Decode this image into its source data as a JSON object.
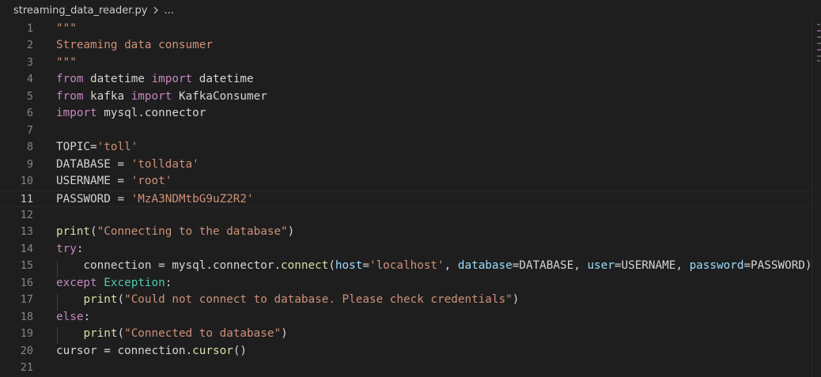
{
  "breadcrumb": {
    "file": "streaming_data_reader.py",
    "more": "..."
  },
  "editor": {
    "active_line": 11,
    "lines": [
      {
        "n": "1",
        "tokens": [
          {
            "t": "\"\"\"",
            "c": "str"
          }
        ]
      },
      {
        "n": "2",
        "tokens": [
          {
            "t": "Streaming data consumer",
            "c": "str"
          }
        ]
      },
      {
        "n": "3",
        "tokens": [
          {
            "t": "\"\"\"",
            "c": "str"
          }
        ]
      },
      {
        "n": "4",
        "tokens": [
          {
            "t": "from",
            "c": "kw"
          },
          {
            "t": " datetime ",
            "c": "plain"
          },
          {
            "t": "import",
            "c": "kw"
          },
          {
            "t": " datetime",
            "c": "plain"
          }
        ]
      },
      {
        "n": "5",
        "tokens": [
          {
            "t": "from",
            "c": "kw"
          },
          {
            "t": " kafka ",
            "c": "plain"
          },
          {
            "t": "import",
            "c": "kw"
          },
          {
            "t": " KafkaConsumer",
            "c": "plain"
          }
        ]
      },
      {
        "n": "6",
        "tokens": [
          {
            "t": "import",
            "c": "kw"
          },
          {
            "t": " mysql.connector",
            "c": "plain"
          }
        ]
      },
      {
        "n": "7",
        "tokens": []
      },
      {
        "n": "8",
        "tokens": [
          {
            "t": "TOPIC=",
            "c": "plain"
          },
          {
            "t": "'toll'",
            "c": "str"
          }
        ]
      },
      {
        "n": "9",
        "tokens": [
          {
            "t": "DATABASE = ",
            "c": "plain"
          },
          {
            "t": "'tolldata'",
            "c": "str"
          }
        ]
      },
      {
        "n": "10",
        "tokens": [
          {
            "t": "USERNAME = ",
            "c": "plain"
          },
          {
            "t": "'root'",
            "c": "str"
          }
        ]
      },
      {
        "n": "11",
        "tokens": [
          {
            "t": "PASSWORD = ",
            "c": "plain"
          },
          {
            "t": "'MzA3NDMtbG9uZ2R2'",
            "c": "str"
          }
        ]
      },
      {
        "n": "12",
        "tokens": []
      },
      {
        "n": "13",
        "tokens": [
          {
            "t": "print",
            "c": "fn"
          },
          {
            "t": "(",
            "c": "plain"
          },
          {
            "t": "\"Connecting to the database\"",
            "c": "str"
          },
          {
            "t": ")",
            "c": "plain"
          }
        ]
      },
      {
        "n": "14",
        "tokens": [
          {
            "t": "try",
            "c": "kw"
          },
          {
            "t": ":",
            "c": "plain"
          }
        ]
      },
      {
        "n": "15",
        "tokens": [
          {
            "t": "    connection = mysql.connector.",
            "c": "plain"
          },
          {
            "t": "connect",
            "c": "fn"
          },
          {
            "t": "(",
            "c": "plain"
          },
          {
            "t": "host",
            "c": "param"
          },
          {
            "t": "=",
            "c": "plain"
          },
          {
            "t": "'localhost'",
            "c": "str"
          },
          {
            "t": ", ",
            "c": "plain"
          },
          {
            "t": "database",
            "c": "param"
          },
          {
            "t": "=DATABASE, ",
            "c": "plain"
          },
          {
            "t": "user",
            "c": "param"
          },
          {
            "t": "=USERNAME, ",
            "c": "plain"
          },
          {
            "t": "password",
            "c": "param"
          },
          {
            "t": "=PASSWORD)",
            "c": "plain"
          }
        ]
      },
      {
        "n": "16",
        "tokens": [
          {
            "t": "except",
            "c": "kw"
          },
          {
            "t": " ",
            "c": "plain"
          },
          {
            "t": "Exception",
            "c": "cls"
          },
          {
            "t": ":",
            "c": "plain"
          }
        ]
      },
      {
        "n": "17",
        "tokens": [
          {
            "t": "    ",
            "c": "plain"
          },
          {
            "t": "print",
            "c": "fn"
          },
          {
            "t": "(",
            "c": "plain"
          },
          {
            "t": "\"Could not connect to database. Please check credentials\"",
            "c": "str"
          },
          {
            "t": ")",
            "c": "plain"
          }
        ]
      },
      {
        "n": "18",
        "tokens": [
          {
            "t": "else",
            "c": "kw"
          },
          {
            "t": ":",
            "c": "plain"
          }
        ]
      },
      {
        "n": "19",
        "tokens": [
          {
            "t": "    ",
            "c": "plain"
          },
          {
            "t": "print",
            "c": "fn"
          },
          {
            "t": "(",
            "c": "plain"
          },
          {
            "t": "\"Connected to database\"",
            "c": "str"
          },
          {
            "t": ")",
            "c": "plain"
          }
        ]
      },
      {
        "n": "20",
        "tokens": [
          {
            "t": "cursor = connection.",
            "c": "plain"
          },
          {
            "t": "cursor",
            "c": "fn"
          },
          {
            "t": "()",
            "c": "plain"
          }
        ]
      },
      {
        "n": "21",
        "tokens": []
      }
    ]
  },
  "colors": {
    "background": "#1e1e1e",
    "string": "#ce9178",
    "keyword": "#c586c0",
    "function": "#dcdcaa",
    "class": "#4ec9b0",
    "parameter": "#9cdcfe",
    "text": "#d4d4d4",
    "line_number": "#858585"
  }
}
